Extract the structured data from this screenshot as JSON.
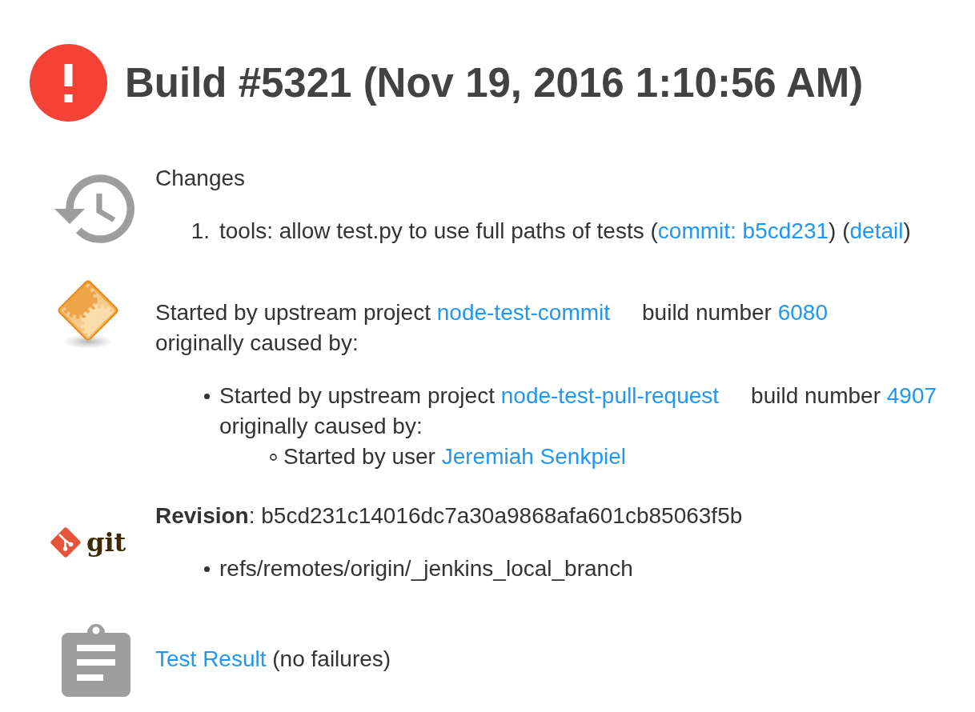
{
  "build": {
    "failed": true,
    "title": "Build #5321 (Nov 19, 2016 1:10:56 AM)"
  },
  "sections": [
    {
      "kind": "changes",
      "heading": "Changes",
      "items": [
        {
          "number": "1.",
          "parts": [
            {
              "kind": "text",
              "text": "tools: allow test.py to use full paths of tests ("
            },
            {
              "kind": "commit",
              "text": "commit: b5cd231"
            },
            {
              "kind": "text",
              "text": ") ("
            },
            {
              "kind": "detail",
              "text": "detail"
            },
            {
              "kind": "text",
              "text": ")"
            }
          ]
        }
      ]
    },
    {
      "kind": "cause",
      "causes": [
        {
          "parts": [
            {
              "kind": "text",
              "text": "Started by upstream project "
            },
            {
              "kind": "project",
              "text": "node-test-commit"
            }
          ],
          "build": [
            {
              "kind": "text",
              "text": "build number "
            },
            {
              "kind": "build",
              "text": "6080"
            }
          ],
          "note": "originally caused by:",
          "children": [
            {
              "parts": [
                {
                  "kind": "text",
                  "text": "Started by upstream project "
                },
                {
                  "kind": "project",
                  "text": "node-test-pull-request"
                }
              ],
              "build": [
                {
                  "kind": "text",
                  "text": "build number "
                },
                {
                  "kind": "build",
                  "text": "4907"
                }
              ],
              "note": "originally caused by:",
              "children": [
                {
                  "parts": [
                    {
                      "kind": "text",
                      "text": "Started by user "
                    },
                    {
                      "kind": "user",
                      "text": "Jeremiah Senkpiel"
                    }
                  ]
                }
              ]
            }
          ]
        }
      ]
    },
    {
      "kind": "revision",
      "logo_text": "git",
      "revision": "**Revision**: b5cd231c14016dc7a30a9868afa601cb85063f5b",
      "branches": [
        "refs/remotes/origin/_jenkins_local_branch"
      ]
    },
    {
      "kind": "tests",
      "parts": [
        {
          "kind": "test_result",
          "text": "Test Result"
        },
        {
          "kind": "text",
          "text": " (no failures)"
        }
      ]
    }
  ]
}
